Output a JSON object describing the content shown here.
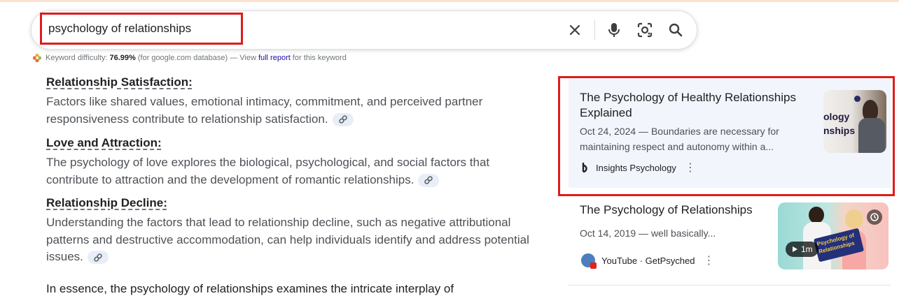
{
  "search": {
    "query": "psychology of relationships"
  },
  "keyword": {
    "label": "Keyword difficulty:",
    "value": "76.99%",
    "db_note": "(for google.com database) — View",
    "link": "full report",
    "suffix": "for this keyword"
  },
  "sections": [
    {
      "heading": "Relationship Satisfaction:",
      "body": "Factors like shared values, emotional intimacy, commitment, and perceived partner responsiveness contribute to relationship satisfaction."
    },
    {
      "heading": "Love and Attraction:",
      "body": "The psychology of love explores the biological, psychological, and social factors that contribute to attraction and the development of romantic relationships."
    },
    {
      "heading": "Relationship Decline:",
      "body": "Understanding the factors that lead to relationship decline, such as negative attributional patterns and destructive accommodation, can help individuals identify and address potential issues."
    }
  ],
  "bottom_text": "In essence, the psychology of relationships examines the intricate interplay of",
  "cards": [
    {
      "title": "The Psychology of Healthy Relationships Explained",
      "snippet": "Oct 24, 2024 — Boundaries are necessary for maintaining respect and autonomy within a...",
      "source": "Insights Psychology",
      "thumb_text_1": "ology",
      "thumb_text_2": "nships"
    },
    {
      "title": "The Psychology of Relationships",
      "snippet": "Oct 14, 2019 — well basically...",
      "source": "YouTube · GetPsyched",
      "duration": "1m",
      "thumb_text": "Psychology of Relationships"
    }
  ],
  "colors": {
    "highlight": "#e01b1b",
    "link": "#1a0dab",
    "card_bg": "#f2f5fb"
  }
}
